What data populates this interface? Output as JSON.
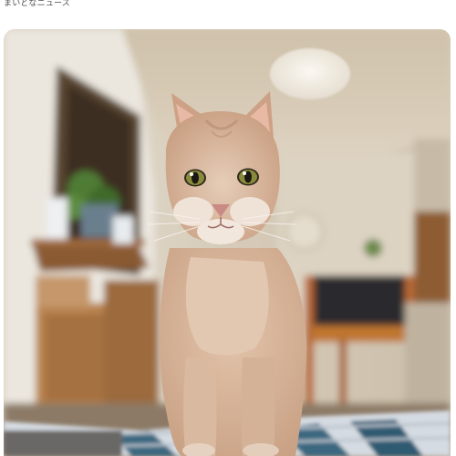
{
  "post": {
    "source_caption": "まいどなニュース"
  },
  "photo": {
    "icon": "cat-photo",
    "colors": {
      "ceiling": "#d8ccb8",
      "wall": "#d3c8b5",
      "shelf_wood": "#a06a3c",
      "cat_fur": "#d6b296",
      "cat_fur_light": "#eadccd",
      "cat_eye": "#8a8a3c",
      "chair": "#b96a34",
      "blanket": "#d7dde4",
      "blanket_stripe": "#3a6780"
    }
  }
}
